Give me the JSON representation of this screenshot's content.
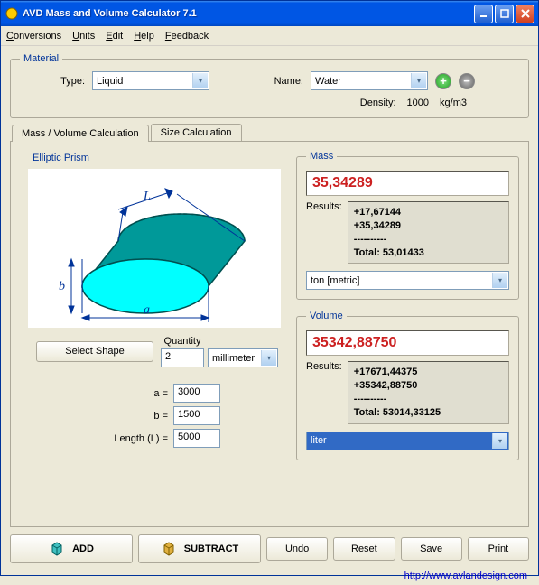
{
  "window": {
    "title": "AVD Mass and Volume Calculator 7.1"
  },
  "menu": {
    "conversions": "Conversions",
    "units": "Units",
    "edit": "Edit",
    "help": "Help",
    "feedback": "Feedback"
  },
  "material": {
    "legend": "Material",
    "type_label": "Type:",
    "type_value": "Liquid",
    "name_label": "Name:",
    "name_value": "Water",
    "density_label": "Density:",
    "density_value": "1000",
    "density_unit": "kg/m3"
  },
  "tabs": {
    "t1": "Mass / Volume  Calculation",
    "t2": "Size Calculation"
  },
  "shape": {
    "name": "Elliptic Prism",
    "select_label": "Select Shape",
    "quantity_label": "Quantity",
    "quantity_value": "2",
    "unit": "millimeter",
    "dims": {
      "a_label": "a =",
      "a_value": "3000",
      "b_label": "b =",
      "b_value": "1500",
      "L_label": "Length (L) =",
      "L_value": "5000"
    }
  },
  "mass": {
    "legend": "Mass",
    "value": "35,34289",
    "results_label": "Results:",
    "results_text": "+17,67144\n+35,34289\n----------\nTotal: 53,01433",
    "unit": "ton [metric]"
  },
  "volume": {
    "legend": "Volume",
    "value": "35342,88750",
    "results_label": "Results:",
    "results_text": "+17671,44375\n+35342,88750\n----------\nTotal: 53014,33125",
    "unit": "liter"
  },
  "buttons": {
    "add": "ADD",
    "subtract": "SUBTRACT",
    "undo": "Undo",
    "reset": "Reset",
    "save": "Save",
    "print": "Print"
  },
  "footer": {
    "link": "http://www.avlandesign.com"
  }
}
